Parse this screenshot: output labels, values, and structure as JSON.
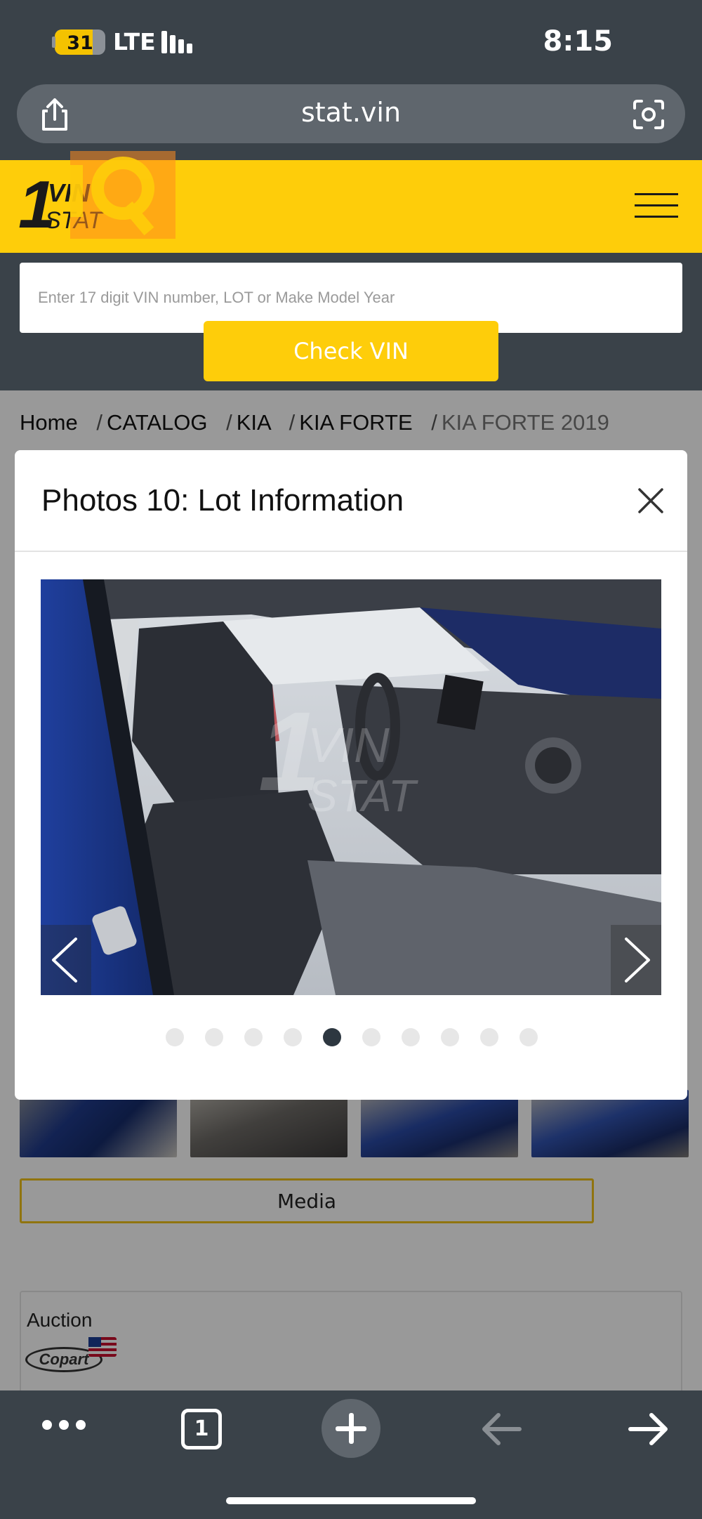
{
  "status_bar": {
    "battery_level": "31",
    "network": "LTE",
    "time": "8:15"
  },
  "browser": {
    "url": "stat.vin",
    "share_icon": "share-icon",
    "lens_icon": "visual-search-icon"
  },
  "site": {
    "logo_number": "1",
    "logo_vin": "VIN",
    "logo_stat": "STAT",
    "menu_icon": "hamburger-menu-icon",
    "brand_color": "#fecd0a"
  },
  "search": {
    "placeholder": "Enter 17 digit VIN number, LOT or Make Model Year",
    "button_label": "Check VIN"
  },
  "breadcrumb": {
    "items": [
      "Home",
      "CATALOG",
      "KIA",
      "KIA FORTE"
    ],
    "separator": "/",
    "current": "KIA FORTE 2019"
  },
  "modal": {
    "title": "Photos 10: Lot Information",
    "close_icon": "close-icon",
    "prev_icon": "chevron-left-icon",
    "next_icon": "chevron-right-icon",
    "photo_count": 10,
    "active_photo_index": 4
  },
  "page": {
    "media_button_label": "Media",
    "auction_label": "Auction",
    "auction_logo": "Copart"
  },
  "toolbar": {
    "tab_count": "1",
    "more_icon": "more-icon",
    "new_tab_icon": "plus-icon",
    "back_icon": "arrow-left-icon",
    "forward_icon": "arrow-right-icon"
  }
}
